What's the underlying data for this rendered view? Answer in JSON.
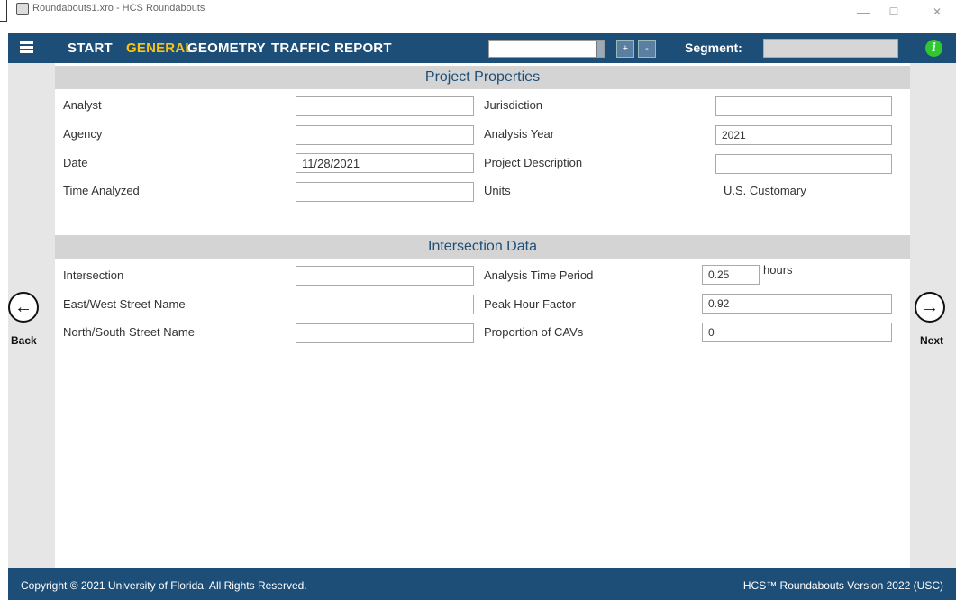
{
  "window": {
    "title": "Roundabouts1.xro - HCS Roundabouts",
    "minimize": "—",
    "maximize": "☐",
    "close": "✕"
  },
  "navbar": {
    "tabs": [
      "START",
      "GENERAL",
      "GEOMETRY",
      "TRAFFIC",
      "REPORT"
    ],
    "active_tab": "GENERAL",
    "segment_select_value": "",
    "add_label": "+",
    "remove_label": "-",
    "segment_label": "Segment:",
    "segment_value": "",
    "info_glyph": "i"
  },
  "side": {
    "back_label": "Back",
    "next_label": "Next",
    "back_glyph": "←",
    "next_glyph": "→"
  },
  "project": {
    "header": "Project Properties",
    "analyst_label": "Analyst",
    "analyst_value": "",
    "agency_label": "Agency",
    "agency_value": "",
    "date_label": "Date",
    "date_value": "11/28/2021",
    "time_analyzed_label": "Time Analyzed",
    "time_analyzed_value": "",
    "jurisdiction_label": "Jurisdiction",
    "jurisdiction_value": "",
    "analysis_year_label": "Analysis Year",
    "analysis_year_value": "2021",
    "project_description_label": "Project Description",
    "project_description_value": "",
    "units_label": "Units",
    "units_value": "U.S. Customary"
  },
  "intersection": {
    "header": "Intersection Data",
    "intersection_label": "Intersection",
    "intersection_value": "",
    "ew_street_label": "East/West Street Name",
    "ew_street_value": "",
    "ns_street_label": "North/South Street Name",
    "ns_street_value": "",
    "analysis_time_period_label": "Analysis Time Period",
    "analysis_time_period_value": "0.25",
    "analysis_time_period_unit": "hours",
    "phf_label": "Peak Hour Factor",
    "phf_value": "0.92",
    "cav_label": "Proportion of CAVs",
    "cav_value": "0"
  },
  "footer": {
    "copyright": "Copyright © 2021 University of Florida. All Rights Reserved.",
    "version": "HCS™ Roundabouts Version 2022 (USC)"
  },
  "colors": {
    "navbar": "#1d4e78",
    "active_tab": "#f5c518",
    "info": "#2fc92f",
    "section_header_bg": "#d4d4d4"
  }
}
